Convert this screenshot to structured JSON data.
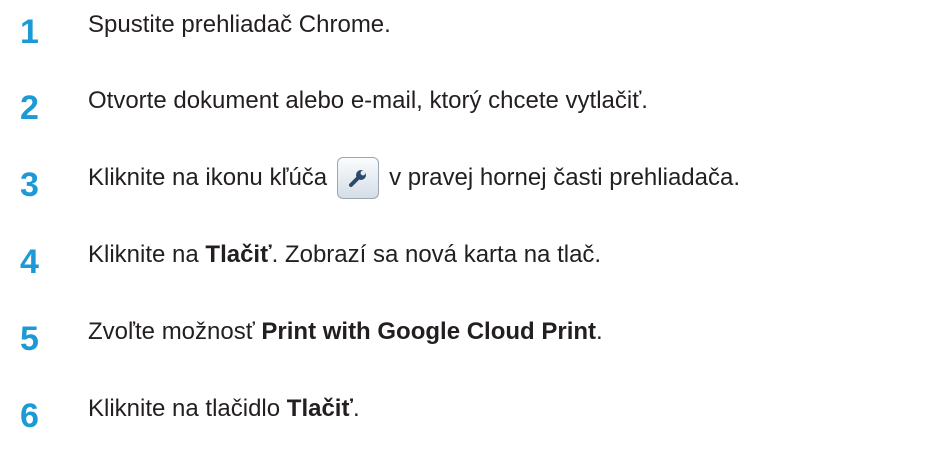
{
  "steps": [
    {
      "number": "1",
      "text": "Spustite prehliadač Chrome."
    },
    {
      "number": "2",
      "text": "Otvorte dokument alebo e-mail, ktorý chcete vytlačiť."
    },
    {
      "number": "3",
      "text_before": "Kliknite na ikonu kľúča",
      "icon": "wrench-icon",
      "text_after": "v pravej hornej časti prehliadača."
    },
    {
      "number": "4",
      "text_before": "Kliknite na ",
      "bold": "Tlačiť",
      "text_after": ". Zobrazí sa nová karta na tlač."
    },
    {
      "number": "5",
      "text_before": "Zvoľte možnosť ",
      "bold": "Print with Google Cloud Print",
      "text_after": "."
    },
    {
      "number": "6",
      "text_before": "Kliknite na tlačidlo ",
      "bold": "Tlačiť",
      "text_after": "."
    }
  ],
  "colors": {
    "step_number": "#1d9ad6",
    "text": "#231f20"
  }
}
